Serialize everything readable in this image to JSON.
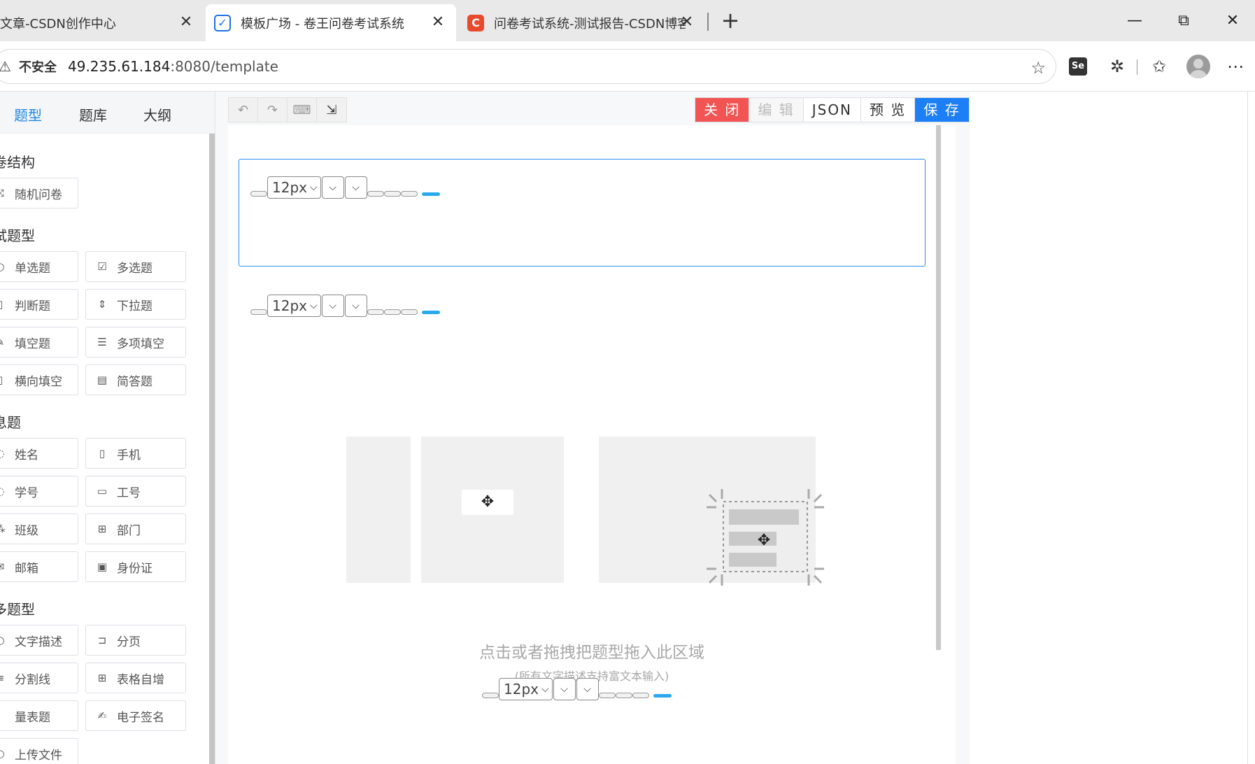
{
  "browser": {
    "tabs": [
      {
        "title": "文章-CSDN创作中心",
        "active": false
      },
      {
        "title": "模板广场 - 卷王问卷考试系统",
        "active": true
      },
      {
        "title": "问卷考试系统-测试报告-CSDN博客",
        "active": false
      }
    ],
    "tab_close": "✕",
    "new_tab": "+",
    "insecure_label": "不安全",
    "url_host": "49.235.61.184",
    "url_rest": ":8080/template",
    "window_controls": {
      "minimize": "—",
      "restore": "⧉",
      "close": "✕"
    }
  },
  "sidebar": {
    "tabs": [
      {
        "label": "题型",
        "active": true
      },
      {
        "label": "题库",
        "active": false
      },
      {
        "label": "大纲",
        "active": false
      }
    ],
    "sections": [
      {
        "title": "卷结构",
        "items": [
          {
            "label": "随机问卷",
            "icon": "shuffle-icon"
          }
        ]
      },
      {
        "title": "试题型",
        "items": [
          {
            "label": "单选题",
            "icon": "radio-icon"
          },
          {
            "label": "多选题",
            "icon": "checkbox-icon"
          },
          {
            "label": "判断题",
            "icon": "judge-icon"
          },
          {
            "label": "下拉题",
            "icon": "sort-icon"
          },
          {
            "label": "填空题",
            "icon": "fill-icon"
          },
          {
            "label": "多项填空",
            "icon": "multi-fill-icon"
          },
          {
            "label": "横向填空",
            "icon": "horizontal-fill-icon"
          },
          {
            "label": "简答题",
            "icon": "document-icon"
          }
        ]
      },
      {
        "title": "息题",
        "items": [
          {
            "label": "姓名",
            "icon": "user-icon"
          },
          {
            "label": "手机",
            "icon": "phone-icon"
          },
          {
            "label": "学号",
            "icon": "student-icon"
          },
          {
            "label": "工号",
            "icon": "badge-icon"
          },
          {
            "label": "班级",
            "icon": "class-icon"
          },
          {
            "label": "部门",
            "icon": "org-icon"
          },
          {
            "label": "邮箱",
            "icon": "mail-icon"
          },
          {
            "label": "身份证",
            "icon": "id-card-icon"
          }
        ]
      },
      {
        "title": "多题型",
        "items": [
          {
            "label": "文字描述",
            "icon": "text-icon"
          },
          {
            "label": "分页",
            "icon": "pagination-icon"
          },
          {
            "label": "分割线",
            "icon": "divider-icon"
          },
          {
            "label": "表格自增",
            "icon": "table-add-icon"
          },
          {
            "label": "量表题",
            "icon": "scale-icon"
          },
          {
            "label": "电子签名",
            "icon": "signature-icon"
          },
          {
            "label": "上传文件",
            "icon": "upload-icon"
          }
        ]
      }
    ]
  },
  "toolbar": {
    "undo_icon": "undo-icon",
    "redo_icon": "redo-icon",
    "keyboard_icon": "keyboard-icon",
    "export_icon": "export-icon",
    "close_label": "关 闭",
    "edit_label": "编 辑",
    "json_label": "JSON",
    "preview_label": "预 览",
    "save_label": "保 存",
    "colors": {
      "close": "#f25454",
      "save": "#1d7ff5",
      "accent": "#1e88e5"
    }
  },
  "editors": [
    {
      "font_size": "12px"
    },
    {
      "font_size": "12px"
    },
    {
      "font_size": "12px"
    }
  ],
  "canvas": {
    "drop_hint": "点击或者拖拽把题型拖入此区域",
    "drop_sub": "(所有文字描述支持富文本输入)"
  }
}
